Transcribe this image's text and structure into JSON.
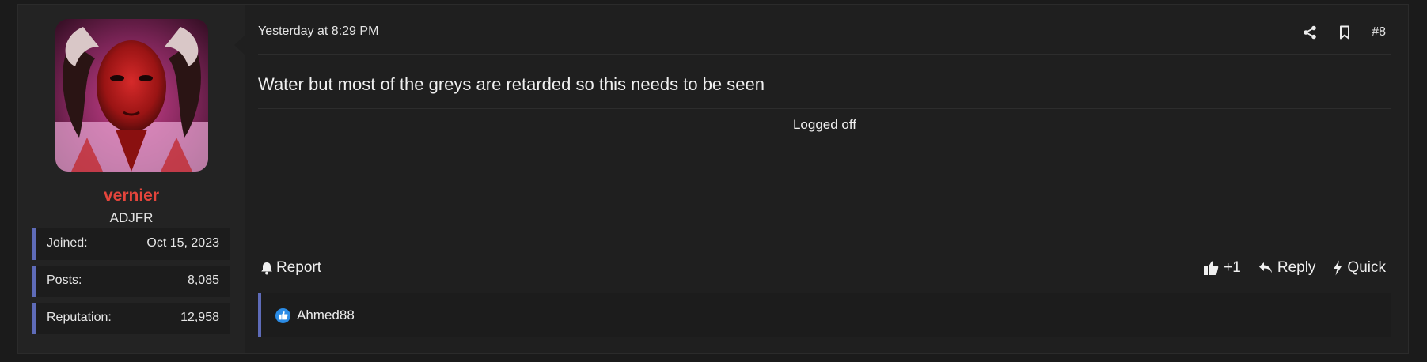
{
  "post": {
    "user": {
      "avatar_icon": "avatar-image",
      "username": "vernier",
      "username_color": "#e5453c",
      "user_title": "ADJFR",
      "stats": [
        {
          "label": "Joined:",
          "value": "Oct 15, 2023"
        },
        {
          "label": "Posts:",
          "value": "8,085"
        },
        {
          "label": "Reputation:",
          "value": "12,958"
        }
      ]
    },
    "header": {
      "date": "Yesterday at 8:29 PM",
      "share_icon": "share-icon",
      "bookmark_icon": "bookmark-icon",
      "post_number": "#8"
    },
    "message": "Water but most of the greys are retarded so this needs to be seen",
    "signature": "Logged off",
    "footer": {
      "report_label": "Report",
      "like_label": "+1",
      "reply_label": "Reply",
      "quick_label": "Quick"
    },
    "reactions": {
      "icon": "like-reaction-icon",
      "users": "Ahmed88"
    },
    "accent_color": "#5e6bb8"
  }
}
